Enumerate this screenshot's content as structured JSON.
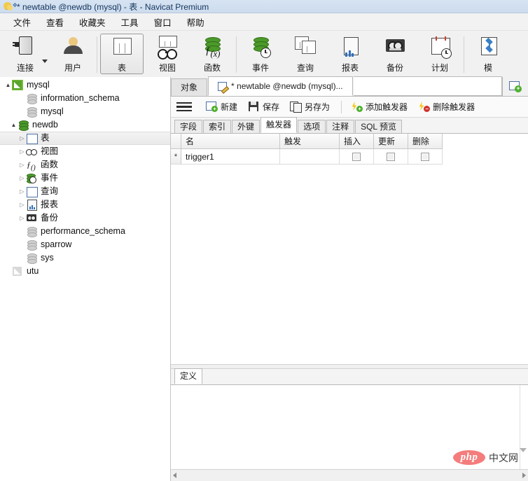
{
  "window": {
    "title": "* newtable @newdb (mysql) - 表 - Navicat Premium",
    "logo_icon": "navicat-logo-icon"
  },
  "menubar": {
    "items": [
      {
        "label": "文件"
      },
      {
        "label": "查看"
      },
      {
        "label": "收藏夹"
      },
      {
        "label": "工具"
      },
      {
        "label": "窗口"
      },
      {
        "label": "帮助"
      }
    ]
  },
  "toolbar": {
    "items": [
      {
        "label": "连接",
        "icon": "connection-icon",
        "has_dropdown": true,
        "selected": false
      },
      {
        "label": "用户",
        "icon": "user-icon",
        "has_dropdown": false,
        "selected": false
      },
      {
        "label": "表",
        "icon": "table-icon",
        "has_dropdown": false,
        "selected": true
      },
      {
        "label": "视图",
        "icon": "view-icon",
        "has_dropdown": false,
        "selected": false
      },
      {
        "label": "函数",
        "icon": "function-icon",
        "has_dropdown": false,
        "selected": false
      },
      {
        "label": "事件",
        "icon": "event-icon",
        "has_dropdown": false,
        "selected": false
      },
      {
        "label": "查询",
        "icon": "query-icon",
        "has_dropdown": false,
        "selected": false
      },
      {
        "label": "报表",
        "icon": "report-icon",
        "has_dropdown": false,
        "selected": false
      },
      {
        "label": "备份",
        "icon": "backup-icon",
        "has_dropdown": false,
        "selected": false
      },
      {
        "label": "计划",
        "icon": "schedule-icon",
        "has_dropdown": false,
        "selected": false
      },
      {
        "label": "模",
        "icon": "model-icon",
        "has_dropdown": false,
        "selected": false
      }
    ]
  },
  "sidebar": {
    "items": [
      {
        "label": "mysql",
        "indent": 0,
        "twisty": "open",
        "icon": "connection-green-icon"
      },
      {
        "label": "information_schema",
        "indent": 1,
        "twisty": "none",
        "icon": "database-gray-icon"
      },
      {
        "label": "mysql",
        "indent": 1,
        "twisty": "none",
        "icon": "database-gray-icon"
      },
      {
        "label": "newdb",
        "indent": 1,
        "twisty": "open",
        "icon": "database-green-icon"
      },
      {
        "label": "表",
        "indent": 2,
        "twisty": "closed",
        "icon": "table-icon",
        "selected": true
      },
      {
        "label": "视图",
        "indent": 2,
        "twisty": "closed",
        "icon": "view-icon"
      },
      {
        "label": "函数",
        "indent": 2,
        "twisty": "closed",
        "icon": "function-icon"
      },
      {
        "label": "事件",
        "indent": 2,
        "twisty": "closed",
        "icon": "event-icon"
      },
      {
        "label": "查询",
        "indent": 2,
        "twisty": "closed",
        "icon": "query-icon"
      },
      {
        "label": "报表",
        "indent": 2,
        "twisty": "closed",
        "icon": "report-icon"
      },
      {
        "label": "备份",
        "indent": 2,
        "twisty": "closed",
        "icon": "backup-icon"
      },
      {
        "label": "performance_schema",
        "indent": 1,
        "twisty": "none",
        "icon": "database-gray-icon"
      },
      {
        "label": "sparrow",
        "indent": 1,
        "twisty": "none",
        "icon": "database-gray-icon"
      },
      {
        "label": "sys",
        "indent": 1,
        "twisty": "none",
        "icon": "database-gray-icon"
      },
      {
        "label": "utu",
        "indent": 0,
        "twisty": "none",
        "icon": "connection-gray-icon"
      }
    ]
  },
  "editor": {
    "tabs": [
      {
        "label": "对象",
        "active": false,
        "icon": null
      },
      {
        "label": "* newtable @newdb (mysql)...",
        "active": true,
        "icon": "table-edit-icon"
      }
    ],
    "new_tab_button": {
      "icon": "new-tab-icon"
    },
    "commands": [
      {
        "label": "新建",
        "icon": "new-icon"
      },
      {
        "label": "保存",
        "icon": "save-icon"
      },
      {
        "label": "另存为",
        "icon": "save-as-icon"
      },
      {
        "label": "添加触发器",
        "icon": "add-trigger-icon"
      },
      {
        "label": "删除触发器",
        "icon": "delete-trigger-icon"
      }
    ],
    "menu_button": {
      "icon": "hamburger-icon"
    },
    "subtabs": [
      {
        "label": "字段",
        "active": false
      },
      {
        "label": "索引",
        "active": false
      },
      {
        "label": "外键",
        "active": false
      },
      {
        "label": "触发器",
        "active": true
      },
      {
        "label": "选项",
        "active": false
      },
      {
        "label": "注释",
        "active": false
      },
      {
        "label": "SQL 预览",
        "active": false
      }
    ]
  },
  "grid": {
    "columns": [
      "名",
      "触发",
      "插入",
      "更新",
      "删除"
    ],
    "rows": [
      {
        "marker": "*",
        "名": "trigger1",
        "触发": "",
        "插入": false,
        "更新": false,
        "删除": false
      }
    ]
  },
  "definition_panel": {
    "tabs": [
      {
        "label": "定义",
        "active": true
      }
    ],
    "content": ""
  },
  "watermark": {
    "badge": "php",
    "text": "中文网",
    "badge_color": "#f47c7c"
  },
  "colors": {
    "titlebar": "#cddcee",
    "toolbar_bg": "#f1f1f1",
    "accent_green": "#4caf2a",
    "accent_red": "#d0342c",
    "selection": "#eeeeee"
  }
}
